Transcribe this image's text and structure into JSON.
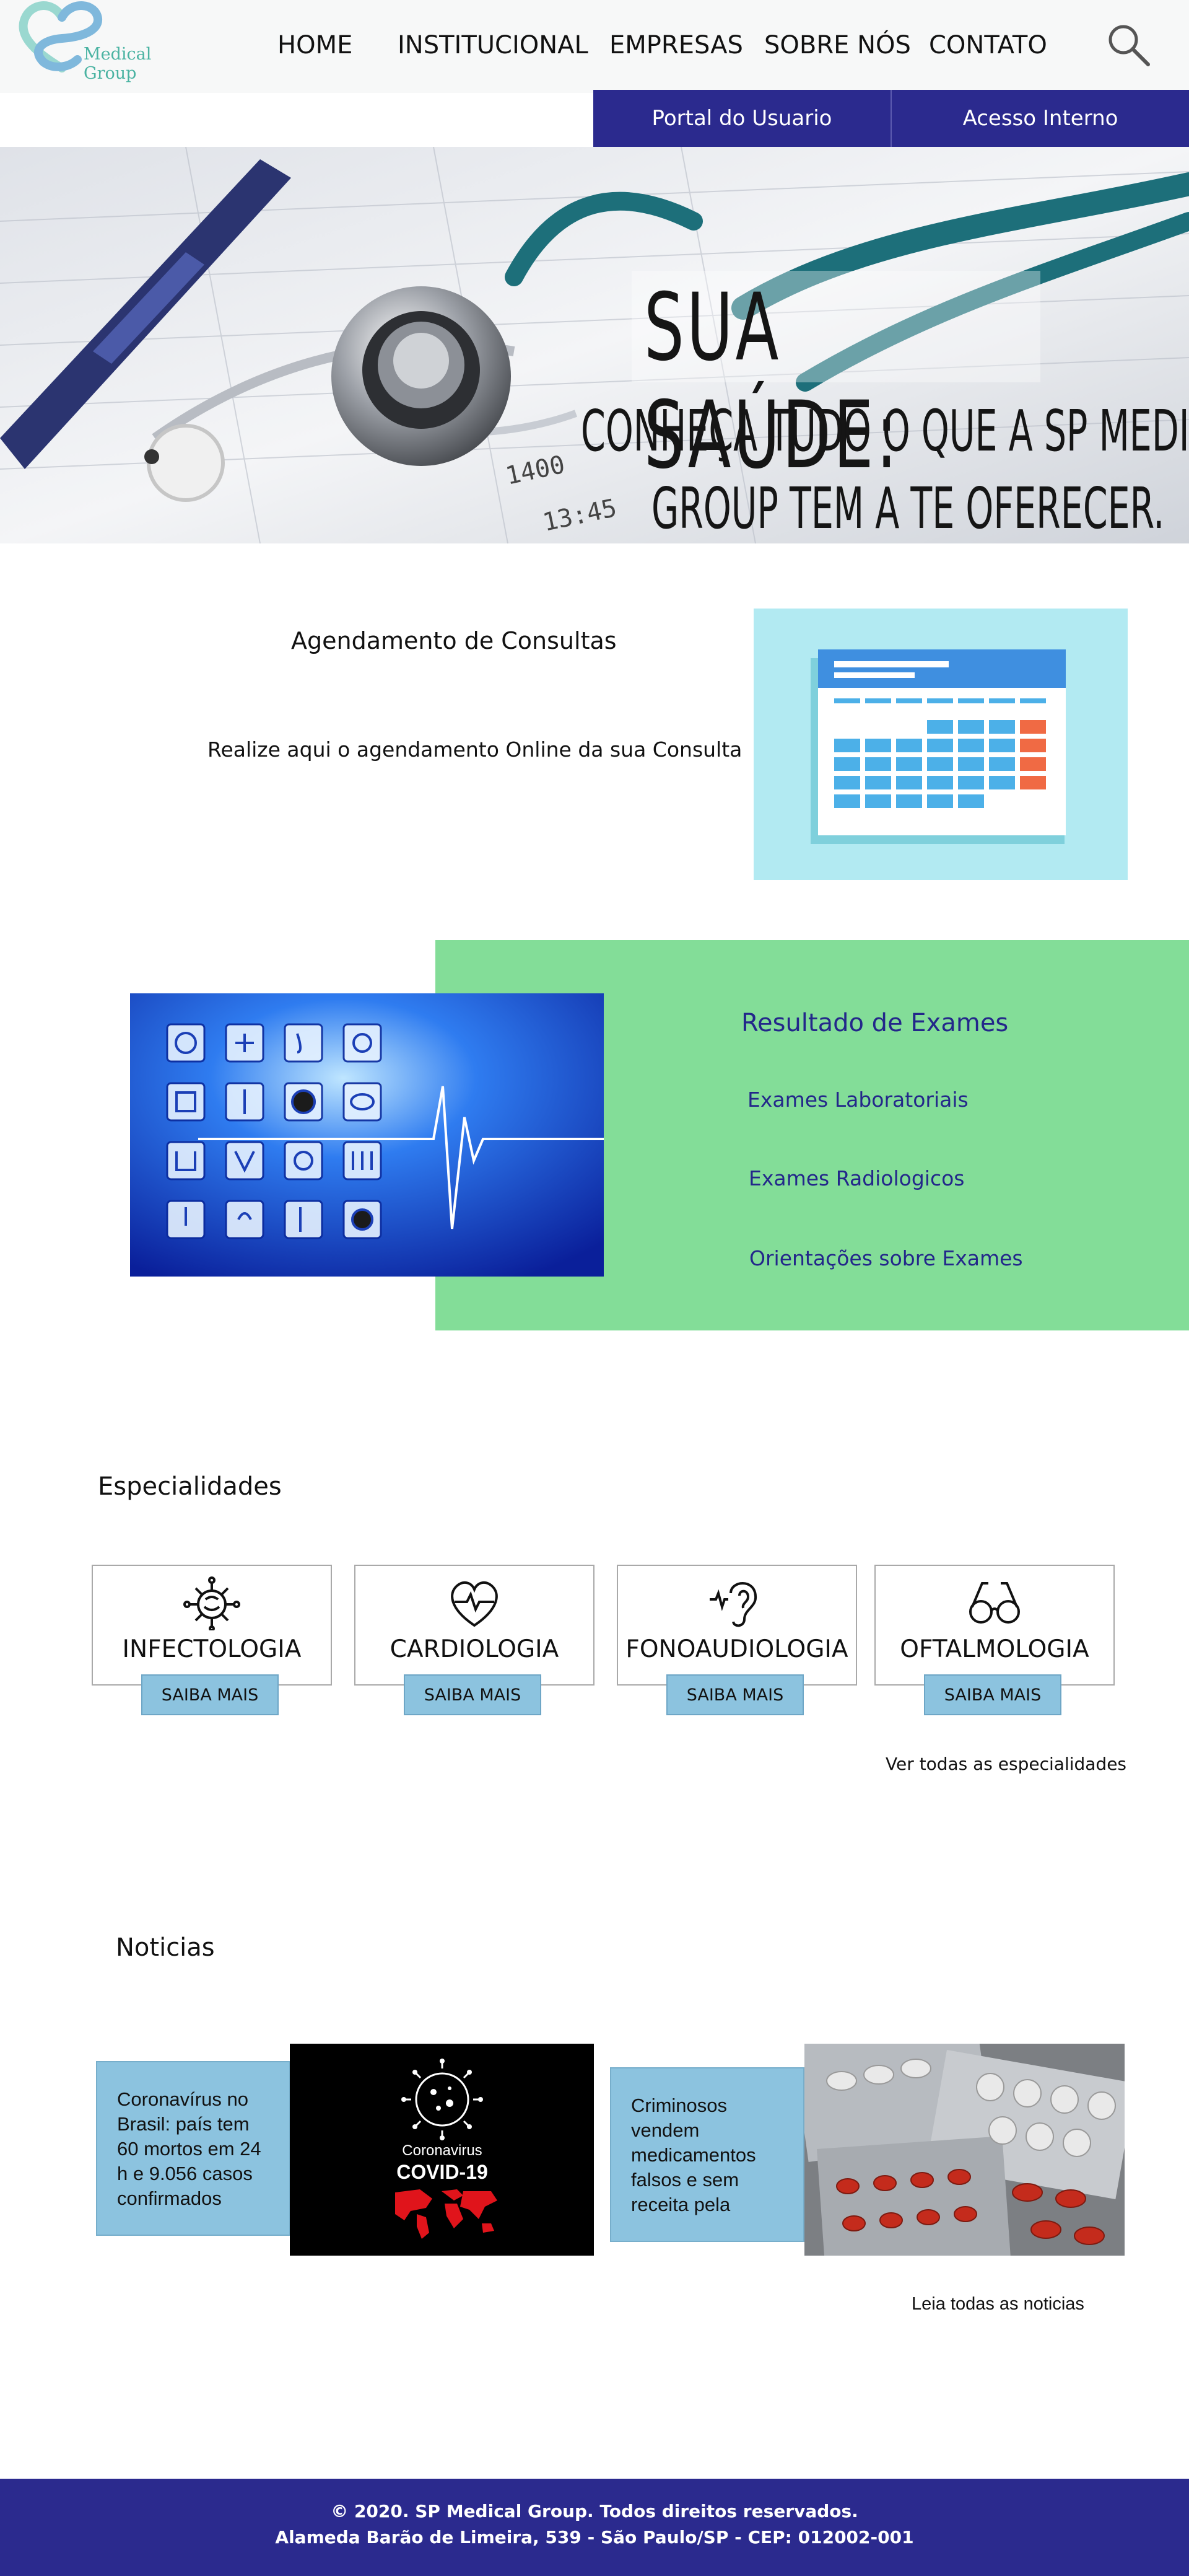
{
  "header": {
    "logo_text": "Medical Group",
    "nav": [
      "HOME",
      "INSTITUCIONAL",
      "EMPRESAS",
      "SOBRE NÓS",
      "CONTATO"
    ],
    "search_icon": "magnifier-icon",
    "portal_buttons": [
      "Portal do Usuario",
      "Acesso Interno"
    ]
  },
  "hero": {
    "title": "SUA SAÚDE:",
    "subtitle_line1": "CONHEÇA TUDO O QUE A SP MEDICAL",
    "subtitle_line2": "GROUP TEM A TE OFERECER.",
    "image_text": [
      "13:45",
      "1400"
    ]
  },
  "agendamento": {
    "title": "Agendamento de Consultas",
    "text": "Realize aqui o agendamento Online da sua Consulta",
    "icon": "calendar-icon"
  },
  "exames": {
    "title": "Resultado de Exames",
    "links": [
      "Exames Laboratoriais",
      "Exames Radiologicos",
      "Orientações sobre Exames"
    ]
  },
  "especialidades": {
    "title": "Especialidades",
    "items": [
      {
        "name": "INFECTOLOGIA",
        "icon": "virus-icon",
        "button": "SAIBA MAIS"
      },
      {
        "name": "CARDIOLOGIA",
        "icon": "heart-pulse-icon",
        "button": "SAIBA MAIS"
      },
      {
        "name": "FONOAUDIOLOGIA",
        "icon": "ear-icon",
        "button": "SAIBA MAIS"
      },
      {
        "name": "OFTALMOLOGIA",
        "icon": "glasses-icon",
        "button": "SAIBA MAIS"
      }
    ],
    "see_all": "Ver todas as especialidades"
  },
  "noticias": {
    "title": "Noticias",
    "items": [
      {
        "text": "Coronavírus no Brasil: país tem 60 mortos em 24 h e 9.056 casos confirmados",
        "image_caption": "Coronavirus",
        "image_title": "COVID-19"
      },
      {
        "text": "Criminosos vendem medicamentos falsos e sem receita pela"
      }
    ],
    "see_all": "Leia todas as noticias"
  },
  "footer": {
    "line1": "© 2020. SP Medical Group. Todos direitos reservados.",
    "line2": "Alameda Barão de Limeira, 539 - São Paulo/SP - CEP: 012002-001"
  },
  "colors": {
    "primary": "#2b2a8e",
    "exam_bg": "#83dd98",
    "calendar_bg": "#b2eaf2",
    "button_bg": "#8cc3df",
    "logo_teal": "#4ab3a2"
  }
}
